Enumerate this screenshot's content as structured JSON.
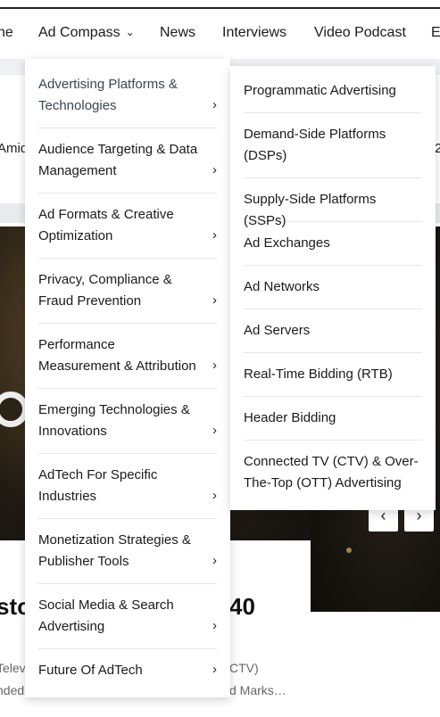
{
  "nav": {
    "items": [
      {
        "label": "ne"
      },
      {
        "label": "Ad Compass",
        "chevron": "chevron-down-icon"
      },
      {
        "label": "News"
      },
      {
        "label": "Interviews"
      },
      {
        "label": "Video Podcast"
      },
      {
        "label": "E"
      }
    ]
  },
  "dropdown": {
    "items": [
      {
        "label": "Advertising Platforms & Technologies"
      },
      {
        "label": "Audience Targeting & Data Management"
      },
      {
        "label": "Ad Formats & Creative Optimization"
      },
      {
        "label": "Privacy, Compliance & Fraud Prevention"
      },
      {
        "label": "Performance Measurement & Attribution"
      },
      {
        "label": "Emerging Technologies & Innovations"
      },
      {
        "label": "AdTech For Specific Industries"
      },
      {
        "label": "Monetization Strategies & Publisher Tools"
      },
      {
        "label": "Social Media & Search Advertising"
      },
      {
        "label": "Future Of AdTech"
      }
    ]
  },
  "submenu": {
    "items": [
      {
        "label": "Programmatic Advertising"
      },
      {
        "label": "Demand-Side Platforms (DSPs)"
      },
      {
        "label": "Supply-Side Platforms (SSPs)"
      },
      {
        "label": "Ad Exchanges"
      },
      {
        "label": "Ad Networks"
      },
      {
        "label": "Ad Servers"
      },
      {
        "label": "Real-Time Bidding (RTB)"
      },
      {
        "label": "Header Bidding"
      },
      {
        "label": "Connected TV (CTV) & Over-The-Top (OTT) Advertising"
      }
    ]
  },
  "background": {
    "snippet_left": "Amid",
    "snippet_right": "2",
    "headline_left": "sto",
    "headline_right": "40",
    "excerpt_line1_left": "Telev",
    "excerpt_line1_right": "CTV)",
    "excerpt_line2_left": "nded",
    "excerpt_line2_right": "d Marks…",
    "slider_prev": "‹",
    "slider_next": "›"
  },
  "colors": {
    "accent_text": "#3b4453",
    "divider": "#e6e6e6",
    "nav_text": "#1a1a1a"
  }
}
